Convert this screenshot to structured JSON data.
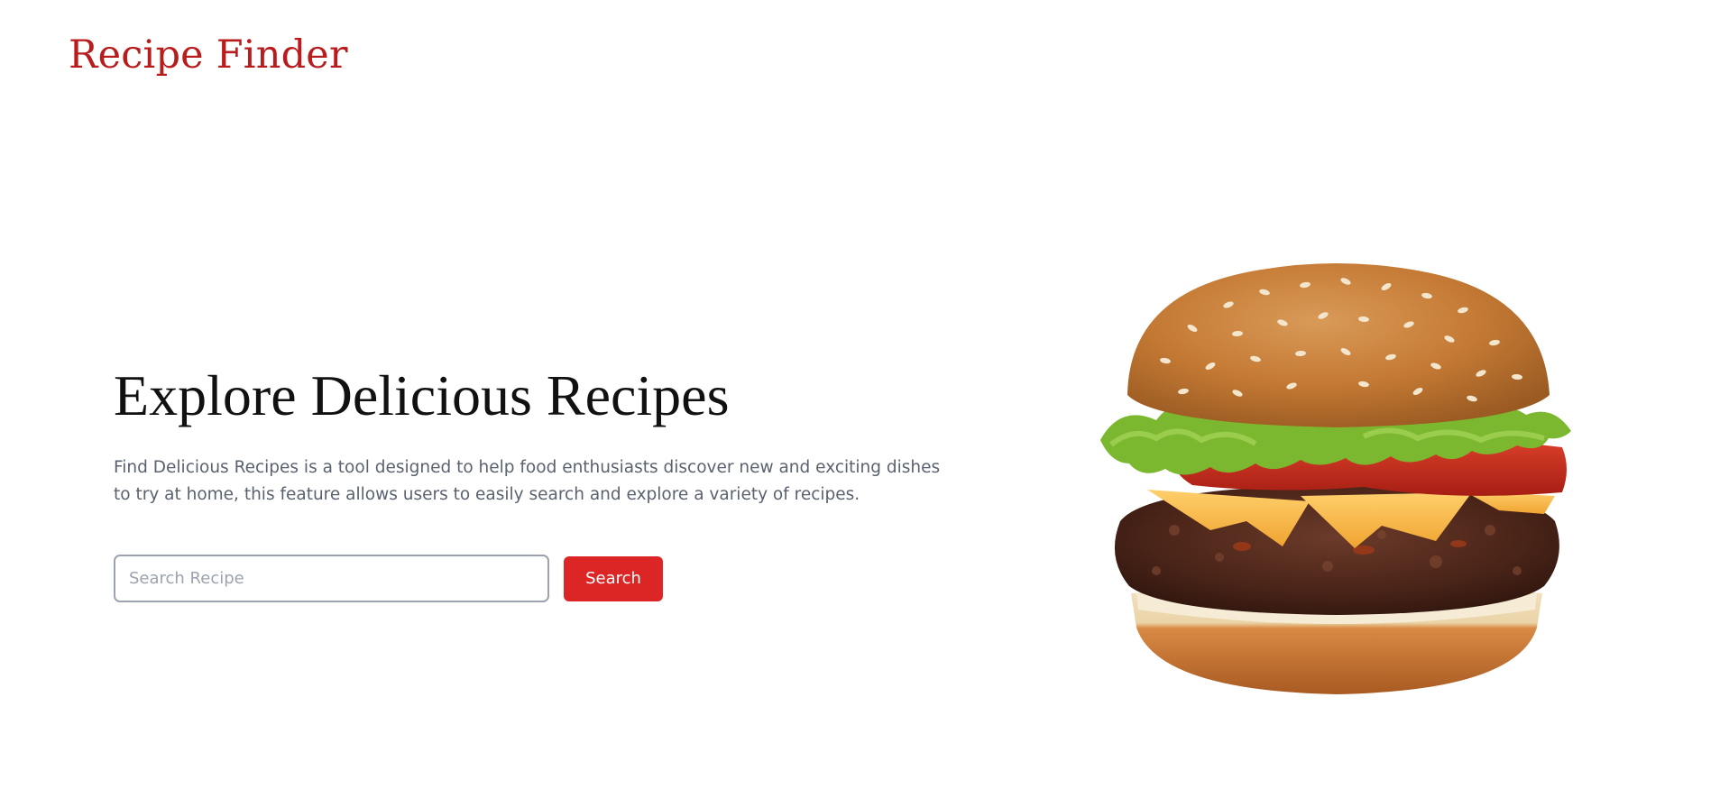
{
  "header": {
    "logo_text": "Recipe Finder"
  },
  "hero": {
    "title": "Explore Delicious Recipes",
    "description": "Find Delicious Recipes is a tool designed to help food enthusiasts discover new and exciting dishes to try at home, this feature allows users to easily search and explore a variety of recipes."
  },
  "search": {
    "placeholder": "Search Recipe",
    "value": "",
    "button_label": "Search"
  },
  "image": {
    "subject": "burger",
    "icon": "burger-image"
  },
  "colors": {
    "brand": "#b91c1c",
    "button": "#dc2626",
    "text_muted": "#5a6270",
    "input_border": "#9ca3af"
  }
}
